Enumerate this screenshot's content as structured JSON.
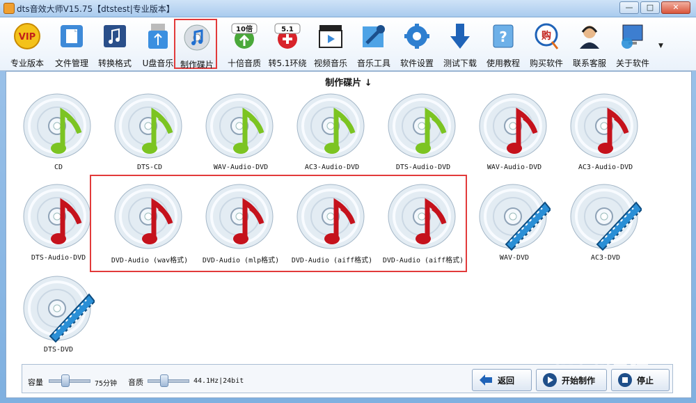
{
  "window": {
    "title": "dts音效大师V15.75【dtstest|专业版本】",
    "btn_min": "—",
    "btn_max": "□",
    "btn_close": "✕"
  },
  "toolbar": {
    "items": [
      {
        "label": "专业版本",
        "icon": "vip-icon"
      },
      {
        "label": "文件管理",
        "icon": "file-icon"
      },
      {
        "label": "转换格式",
        "icon": "convert-icon"
      },
      {
        "label": "U盘音乐",
        "icon": "usb-icon"
      },
      {
        "label": "制作碟片",
        "icon": "disc-music-icon"
      },
      {
        "label": "十倍音质",
        "icon": "10x-quality-icon",
        "badge": "10倍"
      },
      {
        "label": "转5.1环绕",
        "icon": "surround-51-icon",
        "badge": "5.1"
      },
      {
        "label": "视频音乐",
        "icon": "video-music-icon"
      },
      {
        "label": "音乐工具",
        "icon": "music-tools-icon"
      },
      {
        "label": "软件设置",
        "icon": "settings-gear-icon"
      },
      {
        "label": "测试下载",
        "icon": "download-arrow-icon"
      },
      {
        "label": "使用教程",
        "icon": "help-book-icon"
      },
      {
        "label": "购买软件",
        "icon": "buy-icon",
        "badge": "购"
      },
      {
        "label": "联系客服",
        "icon": "support-headset-icon"
      },
      {
        "label": "关于软件",
        "icon": "about-computer-icon"
      }
    ],
    "selected_index": 4
  },
  "section": {
    "title": "制作碟片 ↓"
  },
  "discs": [
    {
      "caption": "CD",
      "note": "green"
    },
    {
      "caption": "DTS-CD",
      "note": "green"
    },
    {
      "caption": "WAV-Audio-DVD",
      "note": "green"
    },
    {
      "caption": "AC3-Audio-DVD",
      "note": "green"
    },
    {
      "caption": "DTS-Audio-DVD",
      "note": "green"
    },
    {
      "caption": "WAV-Audio-DVD",
      "note": "red"
    },
    {
      "caption": "AC3-Audio-DVD",
      "note": "red"
    },
    {
      "caption": "DTS-Audio-DVD",
      "note": "red"
    },
    {
      "caption": "DVD-Audio (wav格式)",
      "note": "red"
    },
    {
      "caption": "DVD-Audio (mlp格式)",
      "note": "red"
    },
    {
      "caption": "DVD-Audio (aiff格式)",
      "note": "red"
    },
    {
      "caption": "DVD-Audio (aiff格式)",
      "note": "red"
    },
    {
      "caption": "WAV-DVD",
      "note": "film"
    },
    {
      "caption": "AC3-DVD",
      "note": "film"
    },
    {
      "caption": "DTS-DVD",
      "note": "film"
    }
  ],
  "status": {
    "capacity_label": "容量",
    "capacity_value": "75分钟",
    "quality_label": "音质",
    "quality_value": "44.1Hz|24bit",
    "back_label": "返回",
    "start_label": "开始制作",
    "stop_label": "停止"
  },
  "watermark": "Baidu经验",
  "colors": {
    "note_green": "#7cc422",
    "note_red": "#c5121c",
    "film_blue": "#2a8fd6",
    "highlight": "#e23a3a"
  }
}
